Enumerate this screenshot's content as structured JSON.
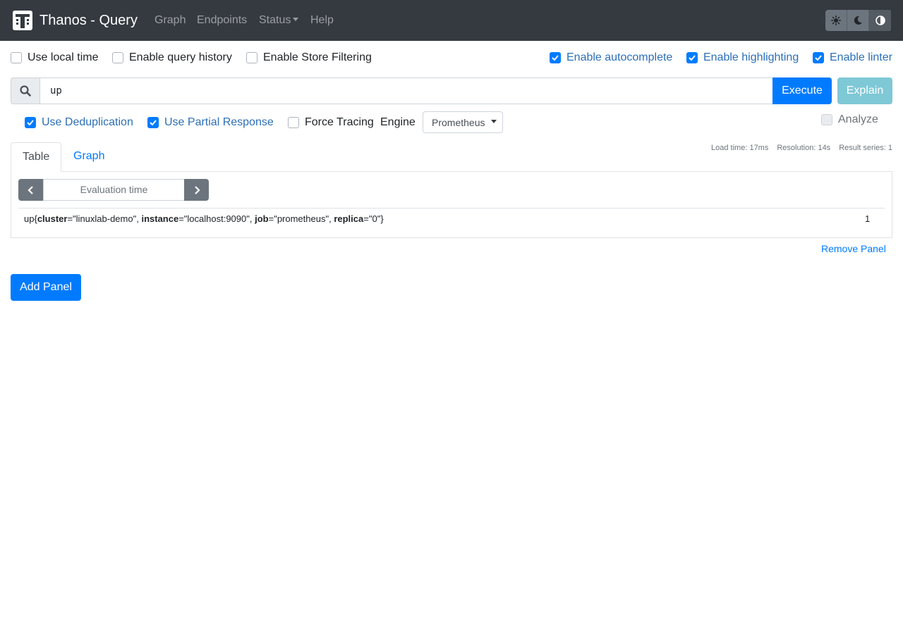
{
  "navbar": {
    "title": "Thanos - Query",
    "links": [
      "Graph",
      "Endpoints",
      "Status",
      "Help"
    ],
    "theme_buttons": [
      "light-theme-icon",
      "dark-theme-icon",
      "browser-theme-icon"
    ]
  },
  "options": {
    "use_local_time": {
      "label": "Use local time",
      "checked": false
    },
    "query_history": {
      "label": "Enable query history",
      "checked": false
    },
    "store_filtering": {
      "label": "Enable Store Filtering",
      "checked": false
    },
    "autocomplete": {
      "label": "Enable autocomplete",
      "checked": true
    },
    "highlighting": {
      "label": "Enable highlighting",
      "checked": true
    },
    "linter": {
      "label": "Enable linter",
      "checked": true
    }
  },
  "query": {
    "value": "up",
    "execute_label": "Execute",
    "explain_label": "Explain"
  },
  "panel_options": {
    "deduplication": {
      "label": "Use Deduplication",
      "checked": true
    },
    "partial_response": {
      "label": "Use Partial Response",
      "checked": true
    },
    "force_tracing": {
      "label": "Force Tracing",
      "checked": false
    },
    "engine_label": "Engine",
    "engine_value": "Prometheus",
    "analyze": {
      "label": "Analyze",
      "checked": false,
      "disabled": true
    }
  },
  "stats": {
    "load_time": "Load time: 17ms",
    "resolution": "Resolution: 14s",
    "result_series": "Result series: 1"
  },
  "tabs": {
    "table": "Table",
    "graph": "Graph"
  },
  "table": {
    "eval_placeholder": "Evaluation time",
    "rows": [
      {
        "metric": "up",
        "labels": [
          {
            "name": "cluster",
            "value": "\"linuxlab-demo\""
          },
          {
            "name": "instance",
            "value": "\"localhost:9090\""
          },
          {
            "name": "job",
            "value": "\"prometheus\""
          },
          {
            "name": "replica",
            "value": "\"0\""
          }
        ],
        "value": "1"
      }
    ]
  },
  "actions": {
    "remove_panel": "Remove Panel",
    "add_panel": "Add Panel"
  },
  "colors": {
    "navbar": "#343a40",
    "primary": "#007bff",
    "info": "#7fc8d6",
    "secondary": "#6c757d"
  }
}
